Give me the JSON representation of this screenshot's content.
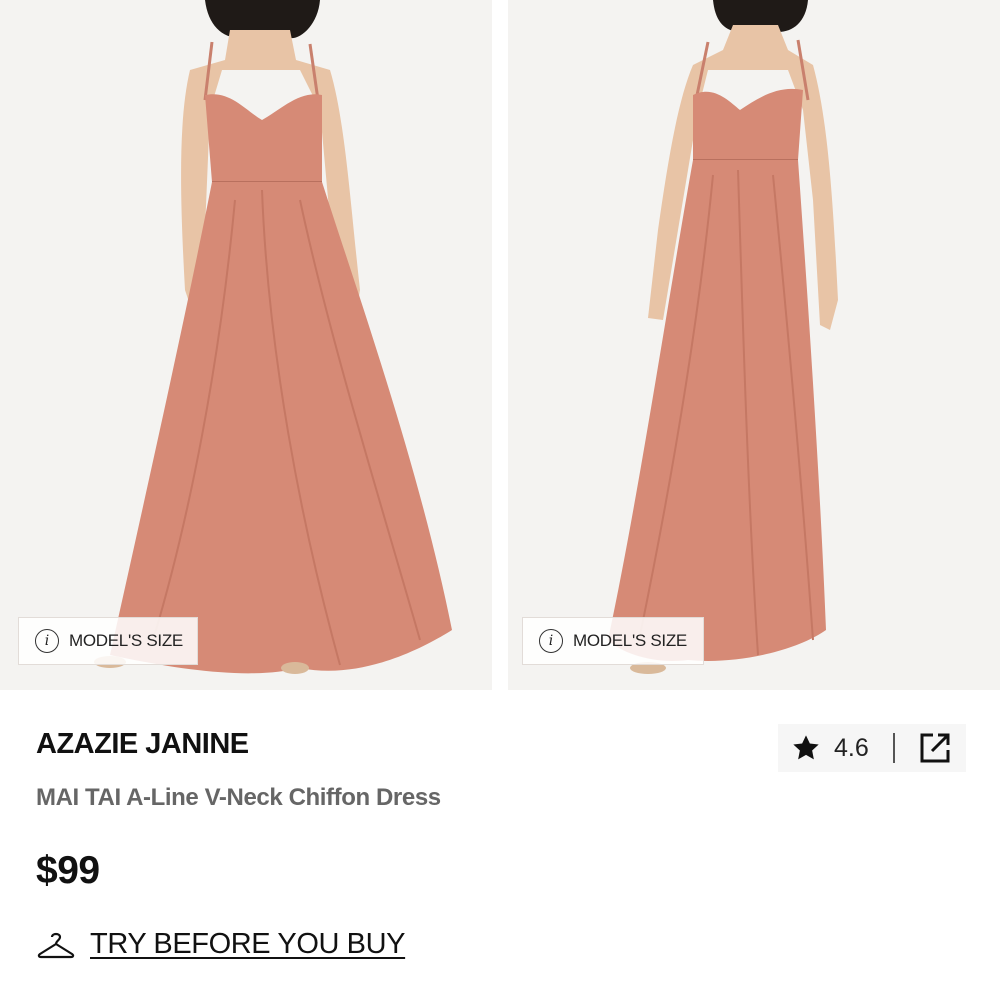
{
  "gallery": {
    "images": [
      {
        "alt": "Front view of model wearing dress",
        "model_size_label": "MODEL'S SIZE"
      },
      {
        "alt": "Side view of model wearing dress",
        "model_size_label": "MODEL'S SIZE"
      }
    ],
    "dress_color": "#d68a76",
    "info_icon_glyph": "i"
  },
  "product": {
    "brand": "AZAZIE JANINE",
    "name": "MAI TAI A-Line V-Neck Chiffon Dress",
    "price": "$99"
  },
  "rating": {
    "value": "4.6",
    "star_icon": "star-icon",
    "share_icon": "share-external-icon"
  },
  "try_before": {
    "icon": "hanger-icon",
    "label": "TRY BEFORE YOU BUY"
  },
  "colors": {
    "brand_text": "#111111",
    "subtitle_text": "#666666",
    "rating_bg": "#f6f6f6"
  }
}
